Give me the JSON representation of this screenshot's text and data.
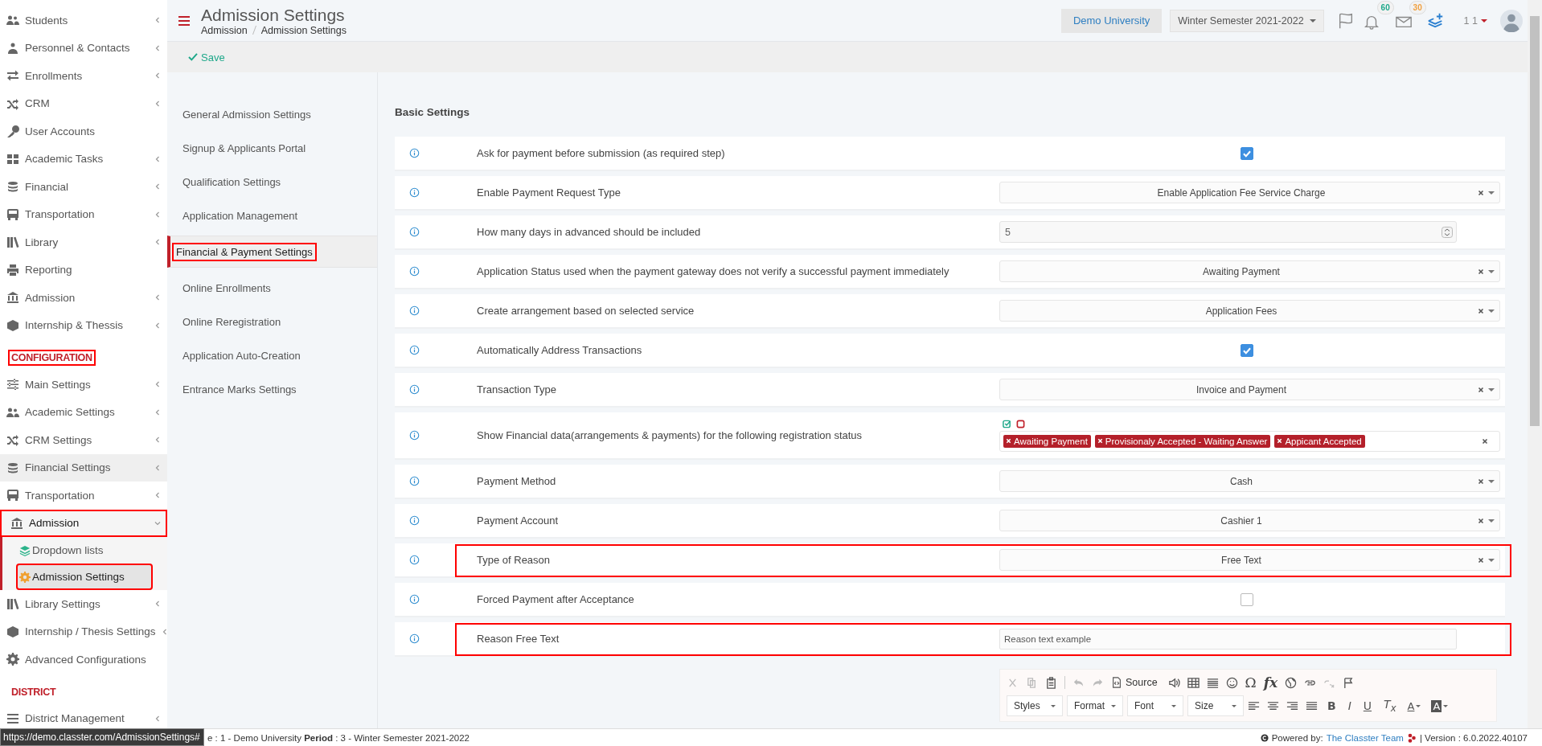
{
  "header": {
    "title": "Admission Settings",
    "breadcrumb": [
      "Admission",
      "Admission Settings"
    ],
    "institution": "Demo University",
    "period": "Winter Semester 2021-2022",
    "notifications": "60",
    "messages": "30",
    "user": "1 1"
  },
  "toolbar": {
    "save": "Save"
  },
  "sidebar": [
    {
      "kind": "item",
      "label": "Students",
      "expandable": true,
      "expanded": false,
      "selected": false,
      "hovered": false,
      "marked": false
    },
    {
      "kind": "item",
      "label": "Personnel & Contacts",
      "expandable": true,
      "expanded": false,
      "selected": false,
      "hovered": false,
      "marked": false
    },
    {
      "kind": "item",
      "label": "Enrollments",
      "expandable": true,
      "expanded": false,
      "selected": false,
      "hovered": false,
      "marked": false
    },
    {
      "kind": "item",
      "label": "CRM",
      "expandable": true,
      "expanded": false,
      "selected": false,
      "hovered": false,
      "marked": false
    },
    {
      "kind": "item",
      "label": "User Accounts",
      "expandable": false,
      "expanded": false,
      "selected": false,
      "hovered": false,
      "marked": false
    },
    {
      "kind": "item",
      "label": "Academic Tasks",
      "expandable": true,
      "expanded": false,
      "selected": false,
      "hovered": false,
      "marked": false
    },
    {
      "kind": "item",
      "label": "Financial",
      "expandable": true,
      "expanded": false,
      "selected": false,
      "hovered": false,
      "marked": false
    },
    {
      "kind": "item",
      "label": "Transportation",
      "expandable": true,
      "expanded": false,
      "selected": false,
      "hovered": false,
      "marked": false
    },
    {
      "kind": "item",
      "label": "Library",
      "expandable": true,
      "expanded": false,
      "selected": false,
      "hovered": false,
      "marked": false
    },
    {
      "kind": "item",
      "label": "Reporting",
      "expandable": false,
      "expanded": false,
      "selected": false,
      "hovered": false,
      "marked": false
    },
    {
      "kind": "item",
      "label": "Admission",
      "expandable": true,
      "expanded": false,
      "selected": false,
      "hovered": false,
      "marked": false
    },
    {
      "kind": "item",
      "label": "Internship & Thessis",
      "expandable": true,
      "expanded": false,
      "selected": false,
      "hovered": false,
      "marked": false
    },
    {
      "kind": "header",
      "label": "CONFIGURATION",
      "marked": true
    },
    {
      "kind": "item",
      "label": "Main Settings",
      "expandable": true,
      "expanded": false,
      "selected": false,
      "hovered": false,
      "marked": false
    },
    {
      "kind": "item",
      "label": "Academic Settings",
      "expandable": true,
      "expanded": false,
      "selected": false,
      "hovered": false,
      "marked": false
    },
    {
      "kind": "item",
      "label": "CRM Settings",
      "expandable": true,
      "expanded": false,
      "selected": false,
      "hovered": false,
      "marked": false
    },
    {
      "kind": "item",
      "label": "Financial Settings",
      "expandable": true,
      "expanded": false,
      "selected": false,
      "hovered": true,
      "marked": false
    },
    {
      "kind": "item",
      "label": "Transportation",
      "expandable": true,
      "expanded": false,
      "selected": false,
      "hovered": false,
      "marked": false
    },
    {
      "kind": "item",
      "label": "Admission",
      "expandable": true,
      "expanded": true,
      "selected": true,
      "hovered": false,
      "marked": true,
      "children": [
        {
          "label": "Dropdown lists",
          "selected": false,
          "marked": false
        },
        {
          "label": "Admission Settings",
          "selected": true,
          "marked": true
        }
      ]
    },
    {
      "kind": "item",
      "label": "Library Settings",
      "expandable": true,
      "expanded": false,
      "selected": false,
      "hovered": false,
      "marked": false
    },
    {
      "kind": "item",
      "label": "Internship / Thesis Settings",
      "expandable": true,
      "expanded": false,
      "selected": false,
      "hovered": false,
      "marked": false
    },
    {
      "kind": "item",
      "label": "Advanced Configurations",
      "expandable": false,
      "expanded": false,
      "selected": false,
      "hovered": false,
      "marked": false
    },
    {
      "kind": "header",
      "label": "DISTRICT",
      "marked": false
    },
    {
      "kind": "item",
      "label": "District Management",
      "expandable": true,
      "expanded": false,
      "selected": false,
      "hovered": false,
      "marked": false
    }
  ],
  "settings_menu": [
    {
      "label": "General Admission Settings",
      "selected": false,
      "marked": false
    },
    {
      "label": "Signup & Applicants Portal",
      "selected": false,
      "marked": false
    },
    {
      "label": "Qualification Settings",
      "selected": false,
      "marked": false
    },
    {
      "label": "Application Management",
      "selected": false,
      "marked": false
    },
    {
      "label": "Financial & Payment Settings",
      "selected": true,
      "marked": true
    },
    {
      "label": "Online Enrollments",
      "selected": false,
      "marked": false
    },
    {
      "label": "Online Reregistration",
      "selected": false,
      "marked": false
    },
    {
      "label": "Application Auto-Creation",
      "selected": false,
      "marked": false
    },
    {
      "label": "Entrance Marks Settings",
      "selected": false,
      "marked": false
    }
  ],
  "section_title": "Basic Settings",
  "settings": [
    {
      "kind": "checkbox",
      "label": "Ask for payment before submission (as required step)",
      "checked": true,
      "marked": false
    },
    {
      "kind": "select",
      "label": "Enable Payment Request Type",
      "value": "Enable Application Fee Service Charge",
      "marked": false
    },
    {
      "kind": "number",
      "label": "How many days in advanced should be included",
      "value": "5",
      "marked": false
    },
    {
      "kind": "select",
      "label": "Application Status used when the payment gateway does not verify a successful payment immediately",
      "value": "Awaiting Payment",
      "marked": false
    },
    {
      "kind": "select",
      "label": "Create arrangement based on selected service",
      "value": "Application Fees",
      "marked": false
    },
    {
      "kind": "checkbox",
      "label": "Automatically Address Transactions",
      "checked": true,
      "marked": false
    },
    {
      "kind": "select",
      "label": "Transaction Type",
      "value": "Invoice and Payment",
      "marked": false
    },
    {
      "kind": "tags",
      "label": "Show Financial data(arrangements & payments) for the following registration status",
      "tags": [
        "Awaiting Payment",
        "Provisionaly Accepted - Waiting Answer",
        "Appicant Accepted"
      ],
      "marked": false
    },
    {
      "kind": "select",
      "label": "Payment Method",
      "value": "Cash",
      "marked": false
    },
    {
      "kind": "select",
      "label": "Payment Account",
      "value": "Cashier 1",
      "marked": false
    },
    {
      "kind": "select",
      "label": "Type of Reason",
      "value": "Free Text",
      "marked": true
    },
    {
      "kind": "checkbox",
      "label": "Forced Payment after Acceptance",
      "checked": false,
      "marked": false
    },
    {
      "kind": "text",
      "label": "Reason Free Text",
      "value": "Reason text example",
      "marked": true
    }
  ],
  "editor": {
    "source": "Source",
    "symbols": [
      "Ω",
      "fx"
    ],
    "dropdowns": [
      "Styles",
      "Format",
      "Font",
      "Size"
    ],
    "formatting": [
      "B",
      "I",
      "U",
      "T$_{x}$"
    ],
    "text_color": "A",
    "background_color": "A"
  },
  "status_bar": {
    "url": "https://demo.classter.com/AdmissionSettings#",
    "info": "e : 1 - Demo University **Period** : 3 - Winter Semester 2021-2022",
    "powered_label": "Powered by:",
    "powered_link": "The Classter Team",
    "version": "| Version : 6.0.2022.40107"
  }
}
